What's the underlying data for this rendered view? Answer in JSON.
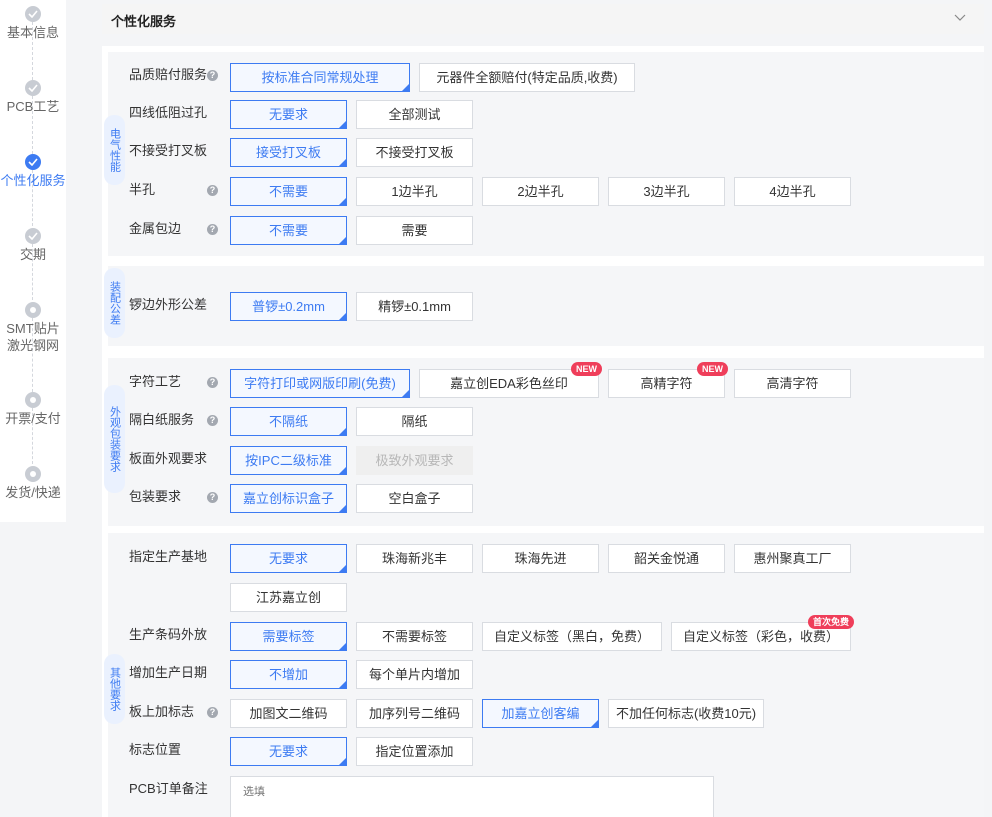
{
  "sidebar": {
    "steps": [
      {
        "label": "基本信息",
        "state": "done"
      },
      {
        "label": "PCB工艺",
        "state": "done"
      },
      {
        "label": "个性化服务",
        "state": "current"
      },
      {
        "label": "交期",
        "state": "done"
      },
      {
        "label": "SMT贴片\n激光钢网",
        "state": "pending"
      },
      {
        "label": "开票/支付",
        "state": "pending"
      },
      {
        "label": "发货/快递",
        "state": "pending"
      }
    ]
  },
  "header": {
    "title": "个性化服务",
    "chevron_icon": "chevron-down-icon"
  },
  "groups": [
    {
      "label": "电气性能"
    },
    {
      "label": "装配公差"
    },
    {
      "label": "外观包装要求"
    },
    {
      "label": "其他要求"
    }
  ],
  "rows": {
    "quality": {
      "label": "品质赔付服务",
      "options": [
        "按标准合同常规处理",
        "元器件全额赔付(特定品质,收费)"
      ]
    },
    "fourwire": {
      "label": "四线低阻过孔",
      "options": [
        "无要求",
        "全部测试"
      ]
    },
    "cross": {
      "label": "不接受打叉板",
      "options": [
        "接受打叉板",
        "不接受打叉板"
      ]
    },
    "halfhole": {
      "label": "半孔",
      "options": [
        "不需要",
        "1边半孔",
        "2边半孔",
        "3边半孔",
        "4边半孔"
      ]
    },
    "edge": {
      "label": "金属包边",
      "options": [
        "不需要",
        "需要"
      ]
    },
    "tolerance": {
      "label": "锣边外形公差",
      "options": [
        "普锣±0.2mm",
        "精锣±0.1mm"
      ]
    },
    "silk": {
      "label": "字符工艺",
      "options": [
        "字符打印或网版印刷(免费)",
        "嘉立创EDA彩色丝印",
        "高精字符",
        "高清字符"
      ],
      "badge": "NEW"
    },
    "paper": {
      "label": "隔白纸服务",
      "options": [
        "不隔纸",
        "隔纸"
      ]
    },
    "appearance": {
      "label": "板面外观要求",
      "options": [
        "按IPC二级标准",
        "极致外观要求"
      ]
    },
    "packing": {
      "label": "包装要求",
      "options": [
        "嘉立创标识盒子",
        "空白盒子"
      ]
    },
    "base": {
      "label": "指定生产基地",
      "options": [
        "无要求",
        "珠海新兆丰",
        "珠海先进",
        "韶关金悦通",
        "惠州聚真工厂",
        "江苏嘉立创"
      ]
    },
    "barcode": {
      "label": "生产条码外放",
      "options": [
        "需要标签",
        "不需要标签",
        "自定义标签（黑白，免费）",
        "自定义标签（彩色，收费）"
      ],
      "badge": "首次免费"
    },
    "date": {
      "label": "增加生产日期",
      "options": [
        "不增加",
        "每个单片内增加"
      ]
    },
    "mark": {
      "label": "板上加标志",
      "options": [
        "加图文二维码",
        "加序列号二维码",
        "加嘉立创客编",
        "不加任何标志(收费10元)"
      ]
    },
    "markpos": {
      "label": "标志位置",
      "options": [
        "无要求",
        "指定位置添加"
      ]
    },
    "remark": {
      "label": "PCB订单备注",
      "placeholder": "选填"
    }
  },
  "help_glyph": "?",
  "colors": {
    "accent": "#3d7bf2",
    "badge": "#ef3e5a",
    "group_bg": "#f5f6f8"
  }
}
